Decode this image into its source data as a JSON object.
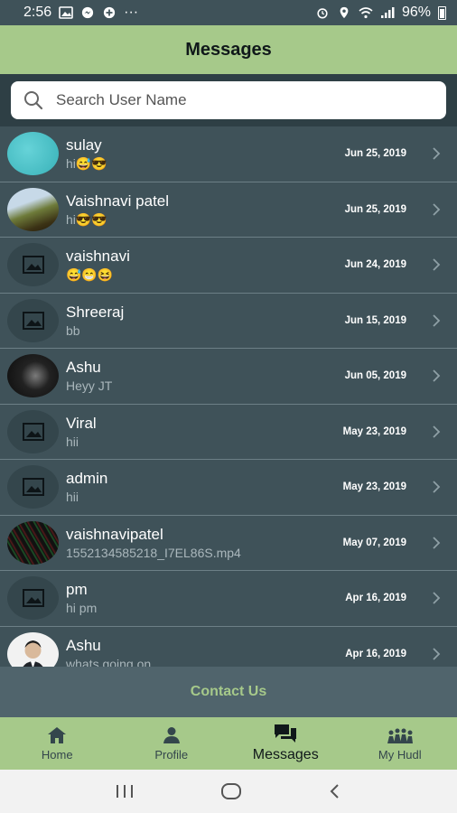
{
  "status_bar": {
    "time": "2:56",
    "more": "···",
    "battery": "96%"
  },
  "header": {
    "title": "Messages"
  },
  "search": {
    "placeholder": "Search User Name"
  },
  "conversations": [
    {
      "name": "sulay",
      "message": "hi😅😎",
      "date": "Jun 25, 2019",
      "avatar": "teal"
    },
    {
      "name": "Vaishnavi patel",
      "message": "hi😎😎",
      "date": "Jun 25, 2019",
      "avatar": "photo1"
    },
    {
      "name": "vaishnavi",
      "message": "😅😁😆",
      "date": "Jun 24, 2019",
      "avatar": "placeholder"
    },
    {
      "name": "Shreeraj",
      "message": "bb",
      "date": "Jun 15, 2019",
      "avatar": "placeholder"
    },
    {
      "name": "Ashu",
      "message": "Heyy JT",
      "date": "Jun 05, 2019",
      "avatar": "photo2"
    },
    {
      "name": "Viral",
      "message": "hii",
      "date": "May 23, 2019",
      "avatar": "placeholder"
    },
    {
      "name": "admin",
      "message": "hii",
      "date": "May 23, 2019",
      "avatar": "placeholder"
    },
    {
      "name": "vaishnavipatel",
      "message": "1552134585218_I7EL86S.mp4",
      "date": "May 07, 2019",
      "avatar": "photo3"
    },
    {
      "name": "pm",
      "message": "hi pm",
      "date": "Apr 16, 2019",
      "avatar": "placeholder"
    },
    {
      "name": "Ashu",
      "message": "whats going on",
      "date": "Apr 16, 2019",
      "avatar": "photo4"
    }
  ],
  "contact": {
    "label": "Contact Us"
  },
  "tabs": [
    {
      "label": "Home",
      "icon": "home-icon"
    },
    {
      "label": "Profile",
      "icon": "person-icon"
    },
    {
      "label": "Messages",
      "icon": "chat-icon",
      "active": true
    },
    {
      "label": "My Hudl",
      "icon": "crowd-icon"
    }
  ],
  "colors": {
    "header_bg": "#a6c98a",
    "list_bg": "#3f5259",
    "accent_text": "#a6c98a"
  }
}
